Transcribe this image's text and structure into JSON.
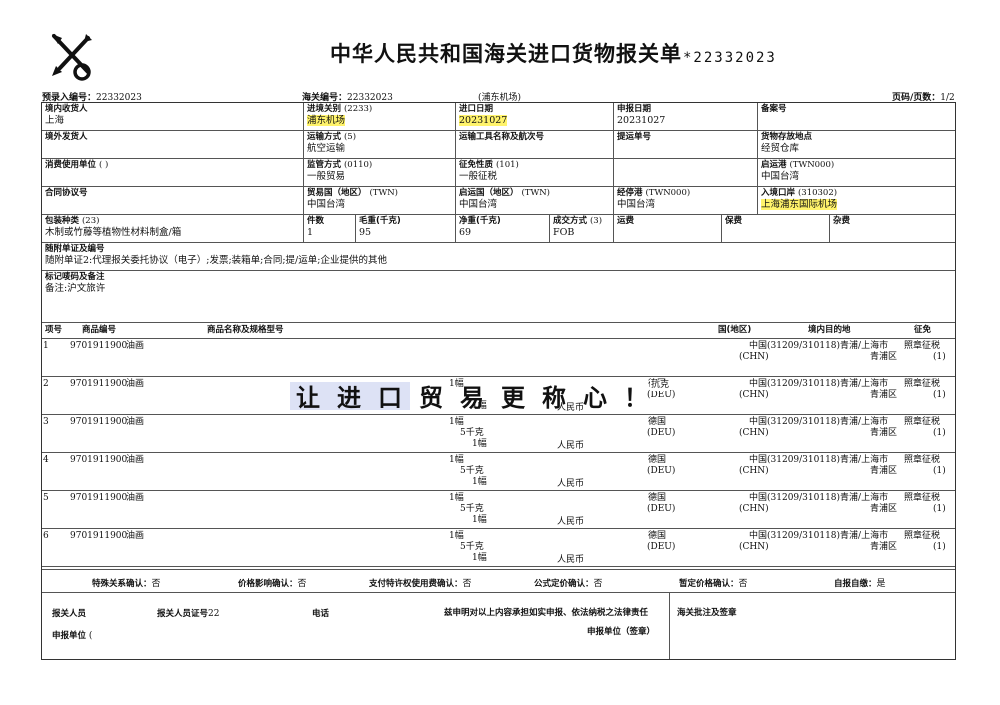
{
  "form": {
    "title": "中华人民共和国海关进口货物报关单",
    "number": "*22332023",
    "pre_entry_label": "预录入编号：",
    "pre_entry_value": "22332023",
    "customs_no_label": "海关编号：",
    "customs_no_value": "22332023",
    "customs_place": "(浦东机场)",
    "page_label": "页码/页数：",
    "page_value": "1/2"
  },
  "fields": {
    "consignee_label": "境内收货人",
    "consignee_value": "上海",
    "entry_customs_label": "进境关别",
    "entry_customs_code": "(2233)",
    "entry_customs_value": "浦东机场",
    "import_date_label": "进口日期",
    "import_date_value": "20231027",
    "declare_date_label": "申报日期",
    "declare_date_value": "20231027",
    "record_no_label": "备案号",
    "consignor_label": "境外发货人",
    "transport_mode_label": "运输方式",
    "transport_mode_code": "(5)",
    "transport_mode_value": "航空运输",
    "transport_tool_label": "运输工具名称及航次号",
    "bill_no_label": "提运单号",
    "storage_label": "货物存放地点",
    "storage_value": "经贸仓库",
    "consumer_label": "消费使用单位",
    "consumer_value": "(                                  )",
    "supervision_label": "监管方式",
    "supervision_code": "(0110)",
    "supervision_value": "一般贸易",
    "levy_label": "征免性质",
    "levy_code": "(101)",
    "levy_value": "一般征税",
    "depart_port_label": "启运港",
    "depart_port_code": "(TWN000)",
    "depart_port_value": "中国台湾",
    "contract_label": "合同协议号",
    "trade_country_label": "贸易国（地区）",
    "trade_country_code": "(TWN)",
    "trade_country_value": "中国台湾",
    "origin_country_label": "启运国（地区）",
    "origin_country_code": "(TWN)",
    "origin_country_value": "中国台湾",
    "stop_port_label": "经停港",
    "stop_port_code": "(TWN000)",
    "stop_port_value": "中国台湾",
    "entry_port_label": "入境口岸",
    "entry_port_code": "(310302)",
    "entry_port_value": "上海浦东国际机场",
    "package_label": "包装种类",
    "package_code": "(23)",
    "package_value": "木制或竹藤等植物性材料制盒/箱",
    "pieces_label": "件数",
    "pieces_value": "1",
    "gross_label": "毛重(千克)",
    "gross_value": "95",
    "net_label": "净重(千克)",
    "net_value": "69",
    "deal_label": "成交方式",
    "deal_code": "(3)",
    "deal_value": "FOB",
    "freight_label": "运费",
    "insurance_label": "保费",
    "misc_label": "杂费",
    "docs_label": "随附单证及编号",
    "docs_value": "随附单证2:代理报关委托协议（电子）;发票;装箱单;合同;提/运单;企业提供的其他",
    "marks_label": "标记唛码及备注",
    "marks_value": "备注:沪文旅许"
  },
  "items_header": {
    "no": "项号",
    "code": "商品编号",
    "name": "商品名称及规格型号",
    "country_partial": "国(地区)",
    "dest": "境内目的地",
    "levy": "征免"
  },
  "items": [
    {
      "no": "1",
      "code": "9701911900",
      "name": "油画",
      "qty1": "",
      "qty2": "",
      "qty3": "",
      "currency": "",
      "origin": "",
      "origin_code": "",
      "dest_country": "中国",
      "dest_country_code": "(CHN)",
      "dest": "(31209/310118)青浦/上海市",
      "dest_district": "青浦区",
      "levy": "照章征税",
      "levy_code": "(1)"
    },
    {
      "no": "2",
      "code": "9701911900",
      "name": "油画",
      "qty1": "1幅",
      "qty2": "",
      "qty3": "1幅",
      "currency": "人民币",
      "origin": "德国",
      "origin_code": "(DEU)",
      "dest_country": "中国",
      "dest_country_code": "(CHN)",
      "dest": "(31209/310118)青浦/上海市",
      "dest_district": "青浦区",
      "levy": "照章征税",
      "levy_code": "(1)"
    },
    {
      "no": "3",
      "code": "9701911900",
      "name": "油画",
      "qty1": "1幅",
      "qty2": "5千克",
      "qty3": "1幅",
      "currency": "人民币",
      "origin": "德国",
      "origin_code": "(DEU)",
      "dest_country": "中国",
      "dest_country_code": "(CHN)",
      "dest": "(31209/310118)青浦/上海市",
      "dest_district": "青浦区",
      "levy": "照章征税",
      "levy_code": "(1)"
    },
    {
      "no": "4",
      "code": "9701911900",
      "name": "油画",
      "qty1": "1幅",
      "qty2": "5千克",
      "qty3": "1幅",
      "currency": "人民币",
      "origin": "德国",
      "origin_code": "(DEU)",
      "dest_country": "中国",
      "dest_country_code": "(CHN)",
      "dest": "(31209/310118)青浦/上海市",
      "dest_district": "青浦区",
      "levy": "照章征税",
      "levy_code": "(1)"
    },
    {
      "no": "5",
      "code": "9701911900",
      "name": "油画",
      "qty1": "1幅",
      "qty2": "5千克",
      "qty3": "1幅",
      "currency": "人民币",
      "origin": "德国",
      "origin_code": "(DEU)",
      "dest_country": "中国",
      "dest_country_code": "(CHN)",
      "dest": "(31209/310118)青浦/上海市",
      "dest_district": "青浦区",
      "levy": "照章征税",
      "levy_code": "(1)"
    },
    {
      "no": "6",
      "code": "9701911900",
      "name": "油画",
      "qty1": "1幅",
      "qty2": "5千克",
      "qty3": "1幅",
      "currency": "人民币",
      "origin": "德国",
      "origin_code": "(DEU)",
      "dest_country": "中国",
      "dest_country_code": "(CHN)",
      "dest": "(31209/310118)青浦/上海市",
      "dest_district": "青浦区",
      "levy": "照章征税",
      "levy_code": "(1)"
    }
  ],
  "slogan": "让进口贸易更称心！",
  "slogan_partial": "抗克",
  "confirm": {
    "special_label": "特殊关系确认：",
    "special_value": "否",
    "price_label": "价格影响确认：",
    "price_value": "否",
    "royalty_label": "支付特许权使用费确认：",
    "royalty_value": "否",
    "formula_label": "公式定价确认：",
    "formula_value": "否",
    "tentative_label": "暂定价格确认：",
    "tentative_value": "否",
    "self_pay_label": "自报自缴：",
    "self_pay_value": "是"
  },
  "footer": {
    "declarant_label": "报关人员",
    "declarant_cert_label": "报关人员证号",
    "declarant_cert_value": "22",
    "phone_label": "电话",
    "statement": "兹申明对以上内容承担如实申报、依法纳税之法律责任",
    "customs_approval_label": "海关批注及签章",
    "declare_unit_label": "申报单位",
    "declare_unit_value": "(",
    "declare_unit_sign": "申报单位（签章）"
  }
}
